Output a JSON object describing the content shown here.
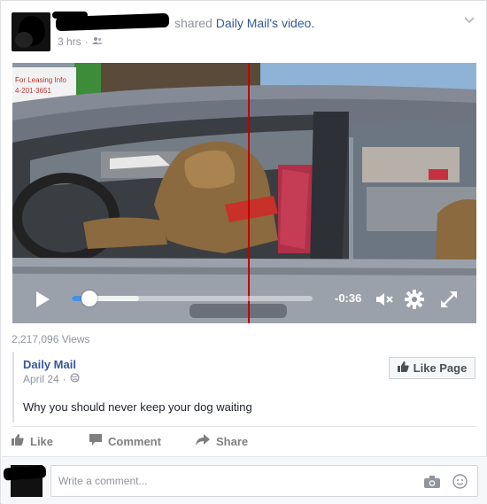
{
  "post": {
    "headline_text": "shared",
    "headline_link": "Daily Mail's video.",
    "time": "3 hrs",
    "audience_icon": "friends-icon",
    "menu_icon": "chevron-down-icon"
  },
  "video": {
    "time_remaining": "-0:36",
    "progress_fraction": 0.075,
    "buffered_fraction": 0.28,
    "accent": "#4a90e2",
    "icons": [
      "play-icon",
      "mute-icon",
      "settings-gear-icon",
      "fullscreen-icon"
    ]
  },
  "stats": {
    "views": "2,217,096 Views"
  },
  "shared_post": {
    "page_name": "Daily Mail",
    "date": "April 24",
    "like_page_label": "Like Page",
    "caption": "Why you should never keep your dog waiting"
  },
  "actions": {
    "like": "Like",
    "comment": "Comment",
    "share": "Share"
  },
  "comment_box": {
    "placeholder": "Write a comment..."
  },
  "scene_sign": {
    "line1": "For Leasing Info",
    "line2": "4-201-3651"
  }
}
